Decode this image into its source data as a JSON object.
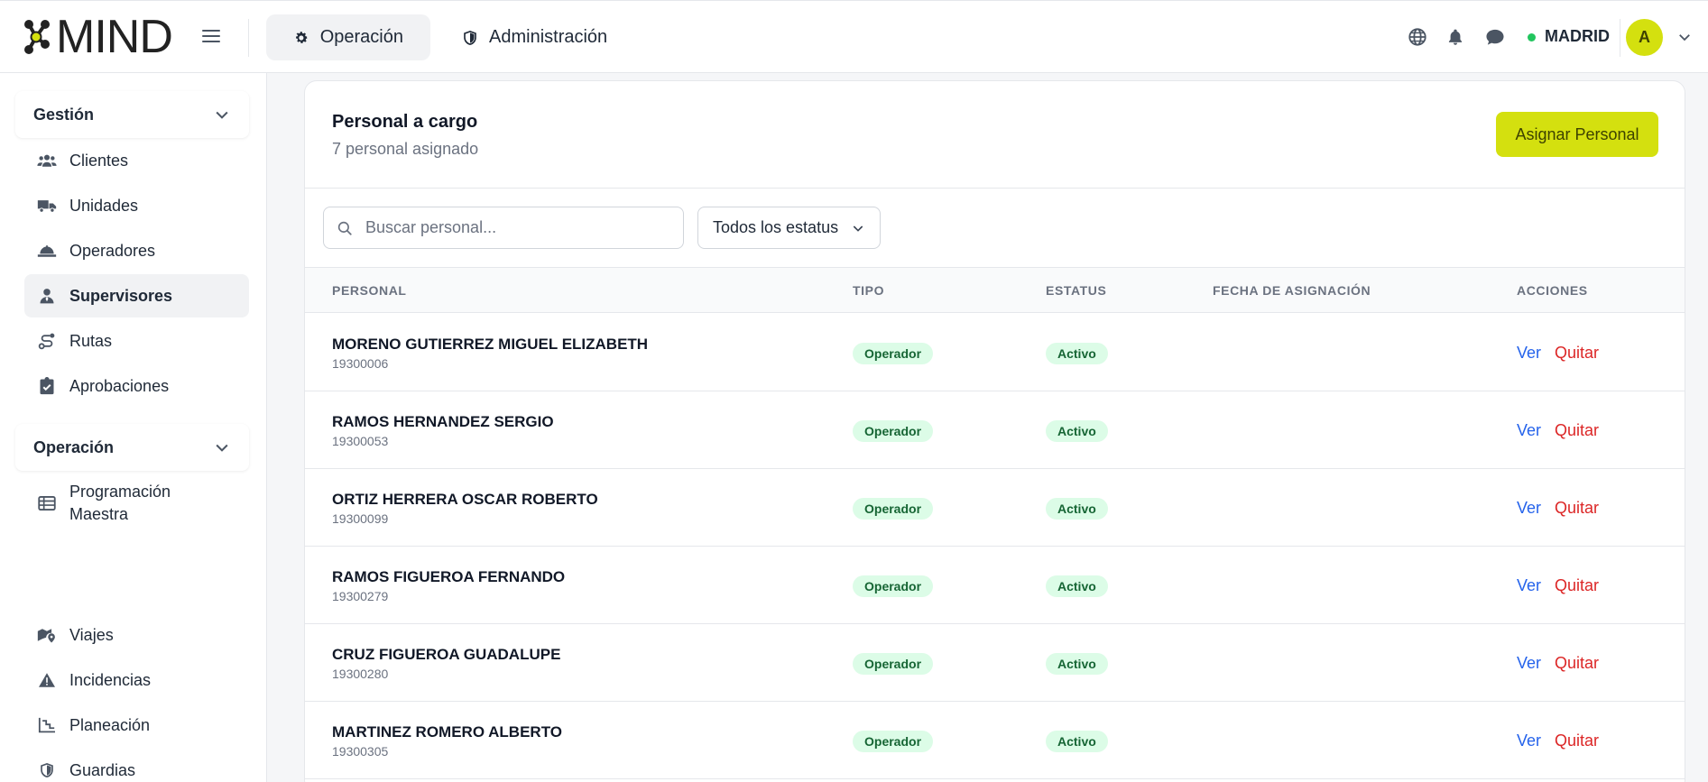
{
  "header": {
    "logo_text": "MIND",
    "tabs": [
      {
        "label": "Operación",
        "icon": "gear-icon",
        "active": true
      },
      {
        "label": "Administración",
        "icon": "shield-icon",
        "active": false
      }
    ],
    "location": "MADRID",
    "location_status_color": "#22c55e",
    "avatar_initial": "A"
  },
  "sidebar": {
    "groups": [
      {
        "title": "Gestión",
        "items": [
          {
            "label": "Clientes",
            "icon": "users-icon"
          },
          {
            "label": "Unidades",
            "icon": "truck-icon"
          },
          {
            "label": "Operadores",
            "icon": "hardhat-icon"
          },
          {
            "label": "Supervisores",
            "icon": "user-tie-icon",
            "active": true
          },
          {
            "label": "Rutas",
            "icon": "route-icon"
          },
          {
            "label": "Aprobaciones",
            "icon": "clipboard-check-icon"
          }
        ]
      },
      {
        "title": "Operación",
        "items": [
          {
            "label": "Programación Maestra",
            "icon": "table-list-icon"
          },
          {
            "label": "Viajes",
            "icon": "map-pin-icon"
          },
          {
            "label": "Incidencias",
            "icon": "warning-icon"
          },
          {
            "label": "Planeación",
            "icon": "chart-steps-icon"
          },
          {
            "label": "Guardias",
            "icon": "shield-icon"
          }
        ]
      }
    ]
  },
  "main": {
    "title": "Personal a cargo",
    "subtitle": "7 personal asignado",
    "assign_button": "Asignar Personal",
    "search_placeholder": "Buscar personal...",
    "status_filter": "Todos los estatus",
    "columns": [
      "PERSONAL",
      "TIPO",
      "ESTATUS",
      "FECHA DE ASIGNACIÓN",
      "ACCIONES"
    ],
    "rows": [
      {
        "name": "MORENO GUTIERREZ MIGUEL ELIZABETH",
        "id": "19300006",
        "tipo": "Operador",
        "estatus": "Activo",
        "fecha": "",
        "ver": "Ver",
        "quitar": "Quitar"
      },
      {
        "name": "RAMOS HERNANDEZ SERGIO",
        "id": "19300053",
        "tipo": "Operador",
        "estatus": "Activo",
        "fecha": "",
        "ver": "Ver",
        "quitar": "Quitar"
      },
      {
        "name": "ORTIZ HERRERA OSCAR ROBERTO",
        "id": "19300099",
        "tipo": "Operador",
        "estatus": "Activo",
        "fecha": "",
        "ver": "Ver",
        "quitar": "Quitar"
      },
      {
        "name": "RAMOS FIGUEROA FERNANDO",
        "id": "19300279",
        "tipo": "Operador",
        "estatus": "Activo",
        "fecha": "",
        "ver": "Ver",
        "quitar": "Quitar"
      },
      {
        "name": "CRUZ FIGUEROA GUADALUPE",
        "id": "19300280",
        "tipo": "Operador",
        "estatus": "Activo",
        "fecha": "",
        "ver": "Ver",
        "quitar": "Quitar"
      },
      {
        "name": "MARTINEZ ROMERO ALBERTO",
        "id": "19300305",
        "tipo": "Operador",
        "estatus": "Activo",
        "fecha": "",
        "ver": "Ver",
        "quitar": "Quitar"
      }
    ]
  },
  "colors": {
    "accent": "#d4e00f",
    "link_blue": "#2563eb",
    "danger_red": "#dc2626",
    "badge_bg": "#dcfce7",
    "badge_text": "#166534"
  }
}
